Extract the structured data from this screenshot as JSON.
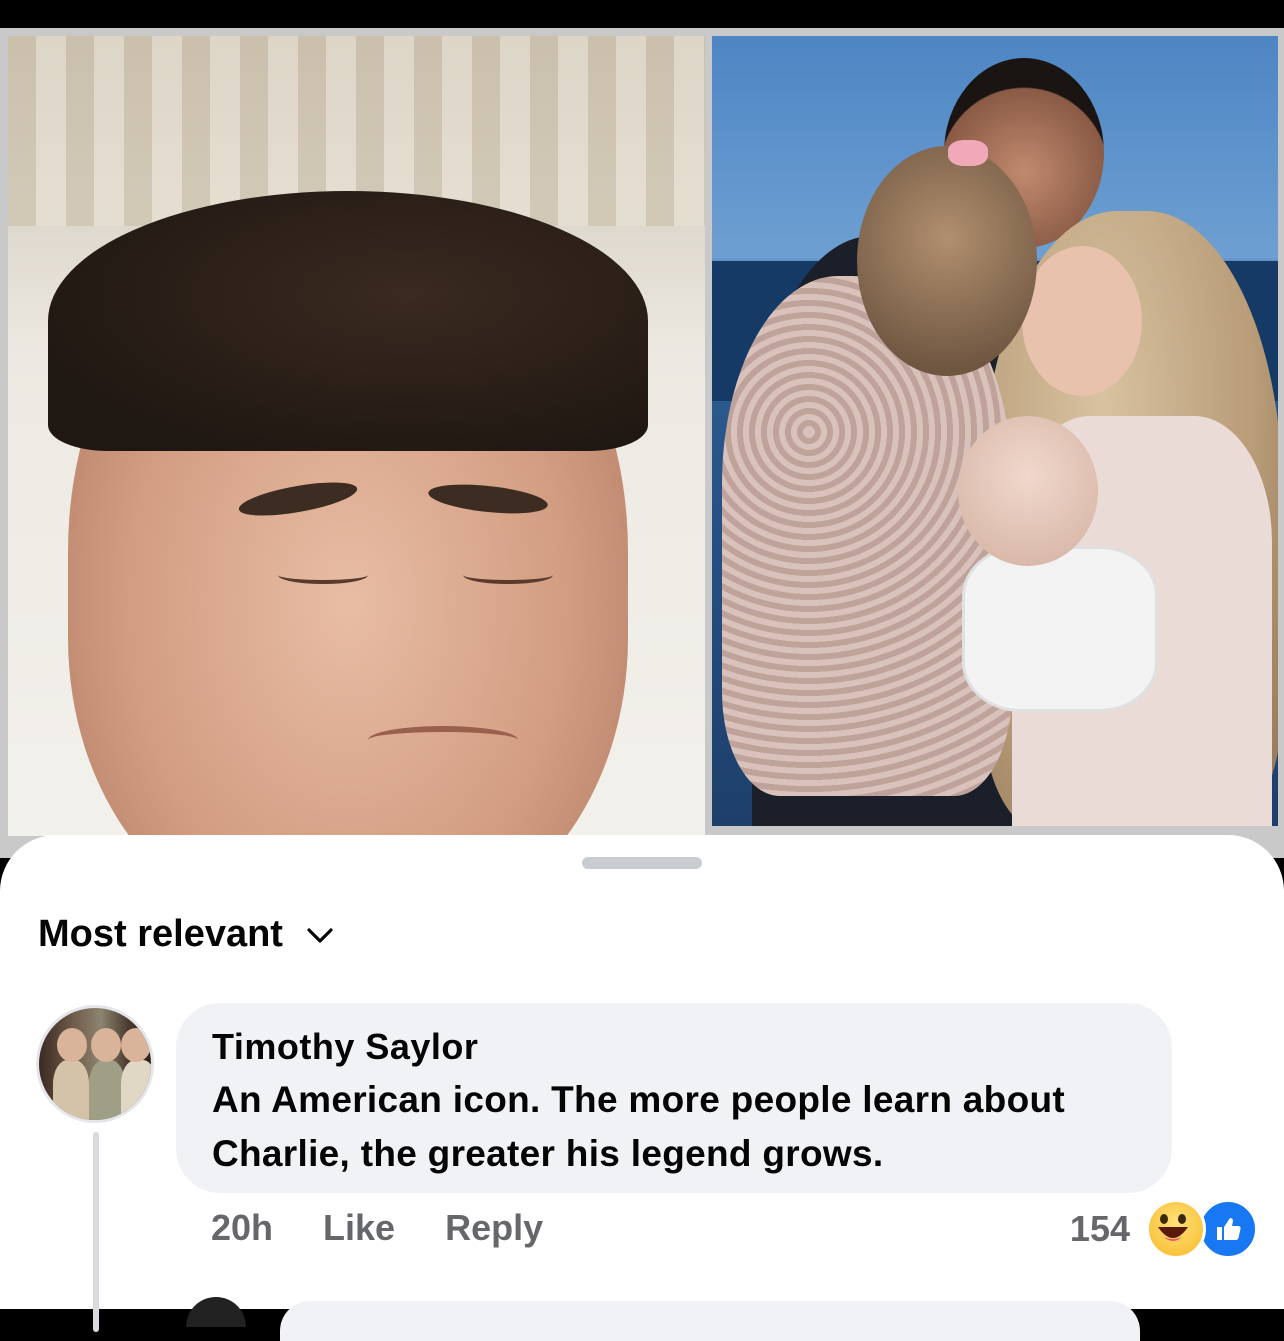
{
  "sheet": {
    "sort_label": "Most relevant"
  },
  "comment": {
    "author": "Timothy Saylor",
    "text_line1": "An American icon.  The more people learn about",
    "text_line2": "Charlie, the greater his legend grows.",
    "time": "20h",
    "like_label": "Like",
    "reply_label": "Reply",
    "reaction_count": "154",
    "reactions": [
      "haha-reaction-icon",
      "like-reaction-icon"
    ]
  },
  "colors": {
    "accent": "#1877f2",
    "bubble": "#f0f2f5",
    "meta_text": "#65676b"
  }
}
